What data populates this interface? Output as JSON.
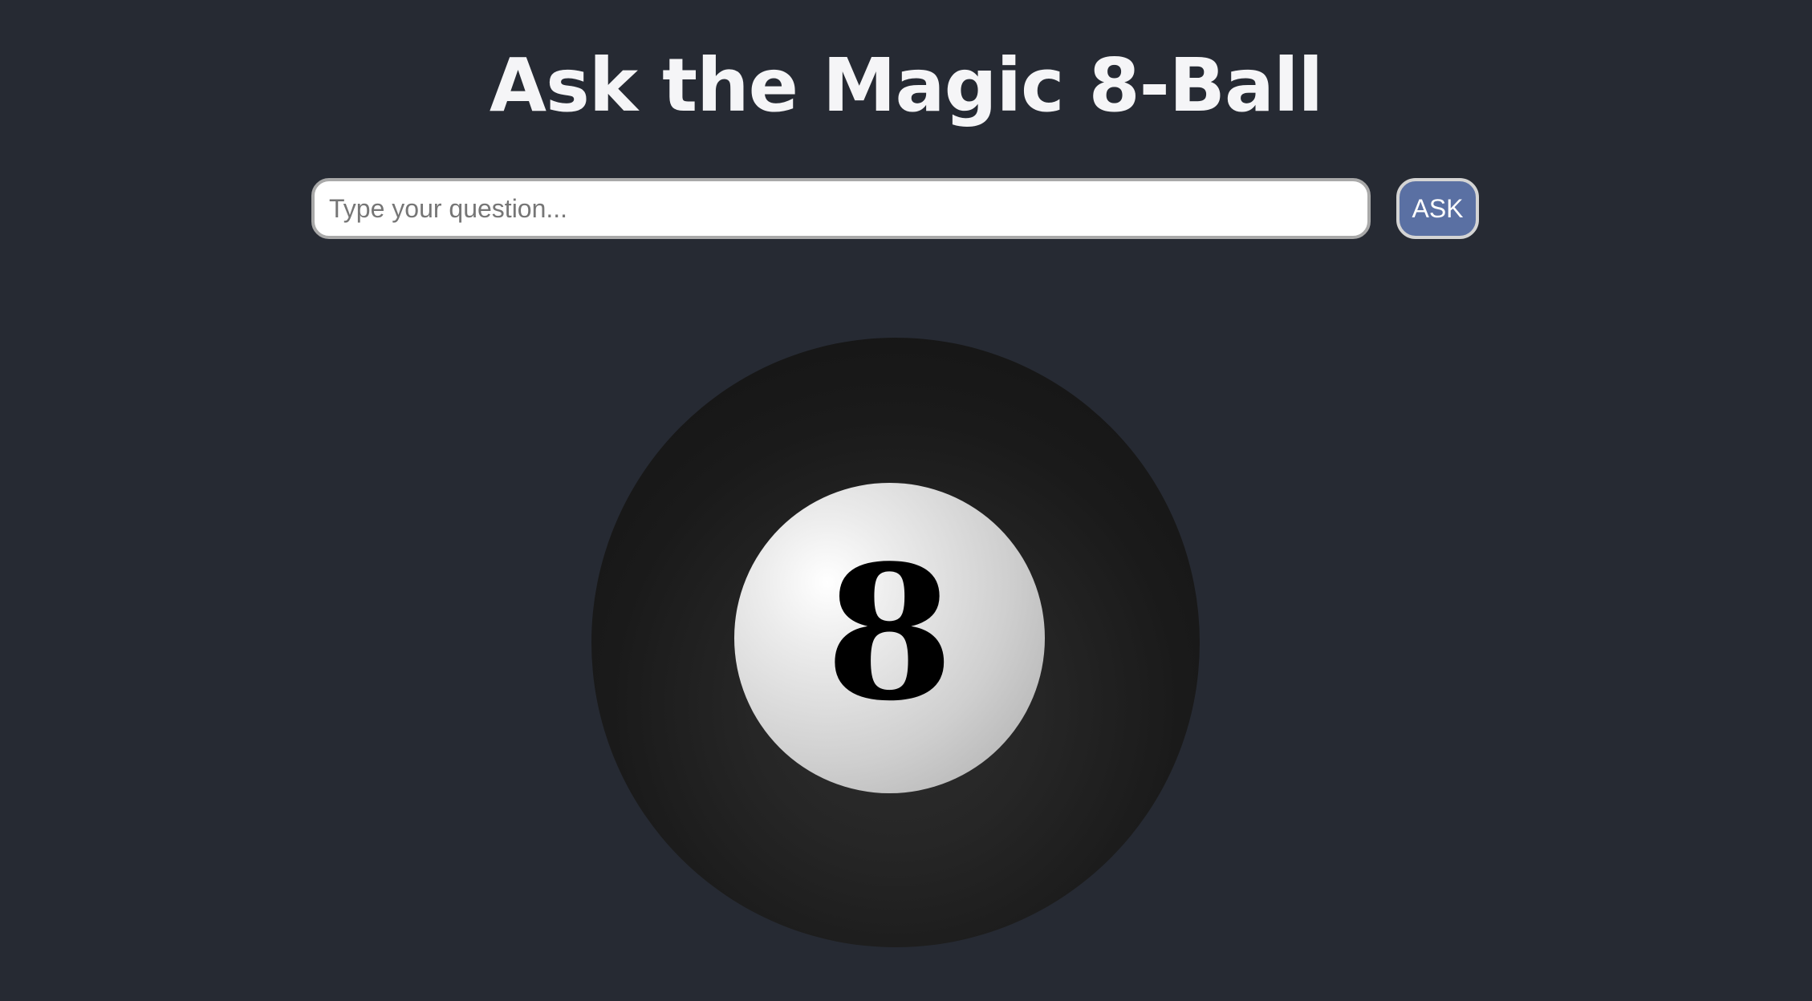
{
  "page": {
    "title": "Ask the Magic 8-Ball"
  },
  "question": {
    "placeholder": "Type your question...",
    "value": ""
  },
  "ask_button": {
    "label": "ASK"
  },
  "ball": {
    "number": "8"
  },
  "colors": {
    "background": "#262a33",
    "title": "#f5f5f7",
    "button": "#5a70a3",
    "ball": "#1a1a1a",
    "ball_window": "#e8e8e8"
  }
}
